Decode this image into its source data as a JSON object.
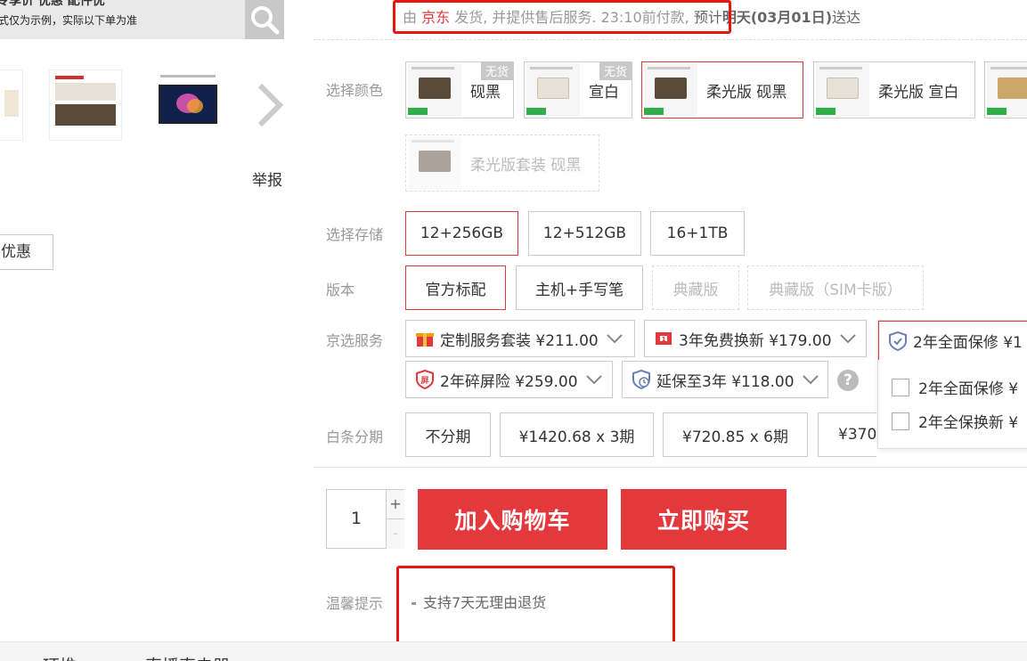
{
  "top_strip": {
    "line1": "专享价          优惠              配件优",
    "line2": "式仅为示例，实际以下单为准"
  },
  "report_label": "举报",
  "coupon_label": "优惠",
  "delivery": {
    "prefix": "由 ",
    "seller": "京东",
    "middle": " 发货, 并提供售后服务. 23:10前付款,",
    "eta_prefix": " 预计",
    "eta_date": "明天(03月01日)",
    "eta_suffix": "送达"
  },
  "color": {
    "label": "选择颜色",
    "options": [
      {
        "name": "砚黑",
        "badge": "无货"
      },
      {
        "name": "宣白",
        "badge": "无货"
      },
      {
        "name": "柔光版 砚黑",
        "badge": ""
      },
      {
        "name": "柔光版 宣白",
        "badge": ""
      },
      {
        "name": "",
        "badge": ""
      },
      {
        "name": "柔光版套装 砚黑",
        "badge": ""
      }
    ]
  },
  "storage": {
    "label": "选择存储",
    "options": [
      "12+256GB",
      "12+512GB",
      "16+1TB"
    ]
  },
  "version": {
    "label": "版本",
    "options": [
      "官方标配",
      "主机+手写笔",
      "典藏版",
      "典藏版（SIM卡版）"
    ]
  },
  "service": {
    "label": "京选服务",
    "items": [
      "定制服务套装 ¥211.00",
      "3年免费换新 ¥179.00",
      "2年全面保修 ¥1",
      "2年碎屏险 ¥259.00",
      "延保至3年 ¥118.00"
    ],
    "help": "?",
    "dropdown": [
      "2年全面保修  ¥",
      "2年全保换新  ¥"
    ]
  },
  "installment": {
    "label": "白条分期",
    "options": [
      "不分期",
      "¥1420.68 x 3期",
      "¥720.85 x 6期",
      "¥370"
    ]
  },
  "quantity": {
    "value": "1",
    "plus": "+",
    "minus": "-"
  },
  "buttons": {
    "cart": "加入购物车",
    "buy": "立即购买"
  },
  "tips": {
    "label": "温馨提示",
    "item": "支持7天无理由退货"
  },
  "bottom": {
    "tab1": "环推",
    "tab2": "直播直电器"
  },
  "colors": {
    "accent": "#e4393c",
    "highlight_box": "#e4170f"
  },
  "icons": [
    "search-icon",
    "chevron-right-icon",
    "gift-icon",
    "refresh-box-icon",
    "shield-icon",
    "screen-shield-icon",
    "clock-shield-icon",
    "chevron-down-icon",
    "help-icon"
  ]
}
